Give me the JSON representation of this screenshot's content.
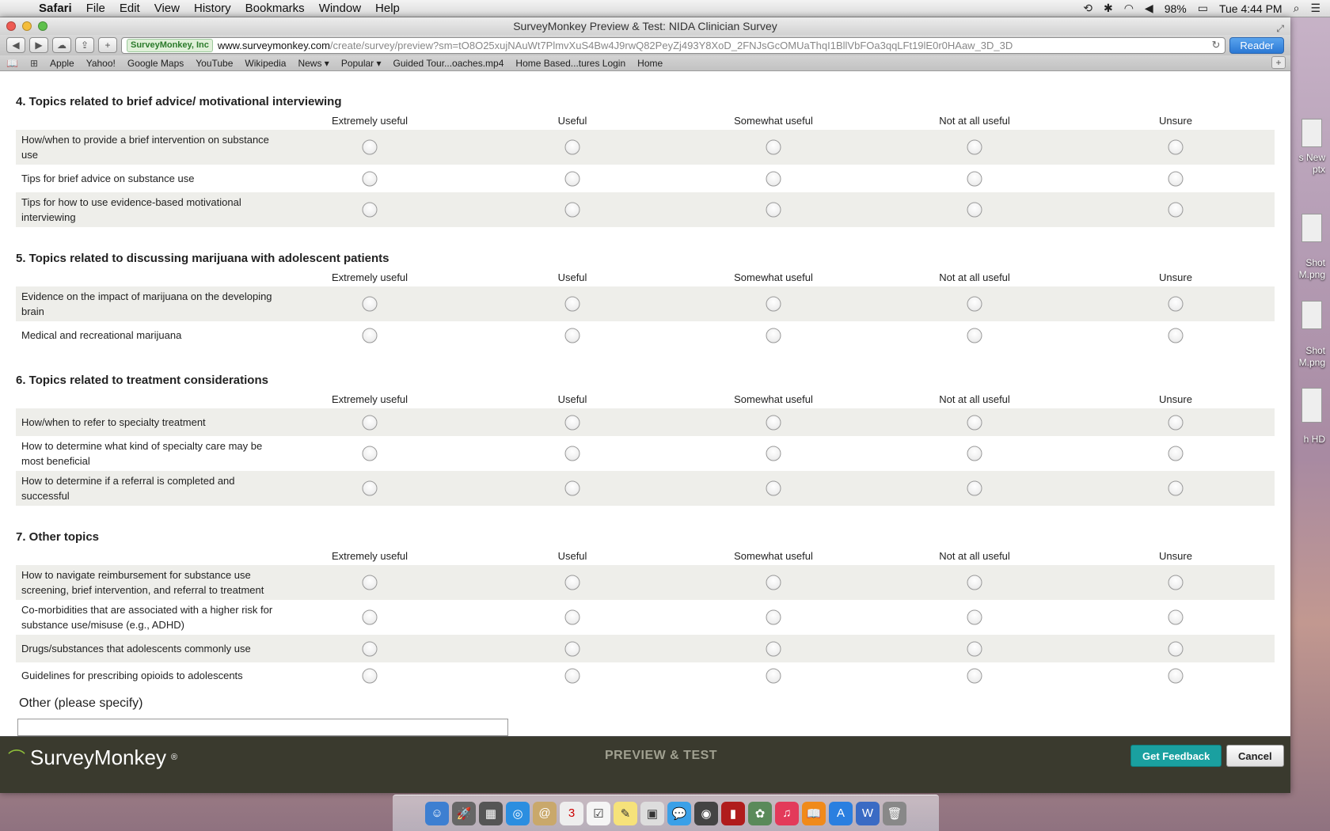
{
  "menubar": {
    "app": "Safari",
    "items": [
      "File",
      "Edit",
      "View",
      "History",
      "Bookmarks",
      "Window",
      "Help"
    ],
    "battery": "98%",
    "clock": "Tue 4:44 PM"
  },
  "window": {
    "title": "SurveyMonkey Preview & Test: NIDA Clinician Survey"
  },
  "toolbar": {
    "site_badge": "SurveyMonkey, Inc",
    "url_domain": "www.surveymonkey.com",
    "url_path": "/create/survey/preview?sm=tO8O25xujNAuWt7PlmvXuS4Bw4J9rwQ82PeyZj493Y8XoD_2FNJsGcOMUaThqI1BllVbFOa3qqLFt19lE0r0HAaw_3D_3D",
    "reader_label": "Reader"
  },
  "bookmarks": [
    "Apple",
    "Yahoo!",
    "Google Maps",
    "YouTube",
    "Wikipedia",
    "News ▾",
    "Popular ▾",
    "Guided Tour...oaches.mp4",
    "Home Based...tures Login",
    "Home"
  ],
  "survey": {
    "columns": [
      "Extremely useful",
      "Useful",
      "Somewhat useful",
      "Not at all useful",
      "Unsure"
    ],
    "questions": [
      {
        "title": "4. Topics related to brief advice/ motivational interviewing",
        "rows": [
          "How/when to provide a brief intervention on substance use",
          "Tips for brief advice on substance use",
          "Tips for how to use evidence-based motivational interviewing"
        ]
      },
      {
        "title": "5. Topics related to discussing marijuana with adolescent patients",
        "rows": [
          "Evidence on the impact of marijuana on the developing brain",
          "Medical and recreational marijuana"
        ]
      },
      {
        "title": "6. Topics related to treatment considerations",
        "rows": [
          "How/when to refer to specialty treatment",
          "How to determine what kind of specialty care may be most beneficial",
          "How to determine if a referral is completed and successful"
        ]
      },
      {
        "title": "7. Other topics",
        "rows": [
          "How to navigate reimbursement for substance use screening, brief intervention, and referral to treatment",
          "Co-morbidities that are associated with a higher risk for substance use/misuse (e.g., ADHD)",
          "Drugs/substances that adolescents commonly use",
          "Guidelines for prescribing opioids to adolescents"
        ]
      }
    ],
    "other_label": "Other (please specify)"
  },
  "footer": {
    "logo": "SurveyMonkey",
    "mode": "PREVIEW & TEST",
    "feedback_button": "Get Feedback",
    "cancel_button": "Cancel"
  },
  "desktop": {
    "items": [
      "s New\nptx",
      "Shot\nM.png",
      "Shot\nM.png",
      "h HD"
    ]
  },
  "colors": {
    "footer_bg": "#3a3a2e",
    "feedback_btn": "#1aa0a0",
    "row_alt": "#eeeeea",
    "logo_green": "#8fbf3a"
  }
}
